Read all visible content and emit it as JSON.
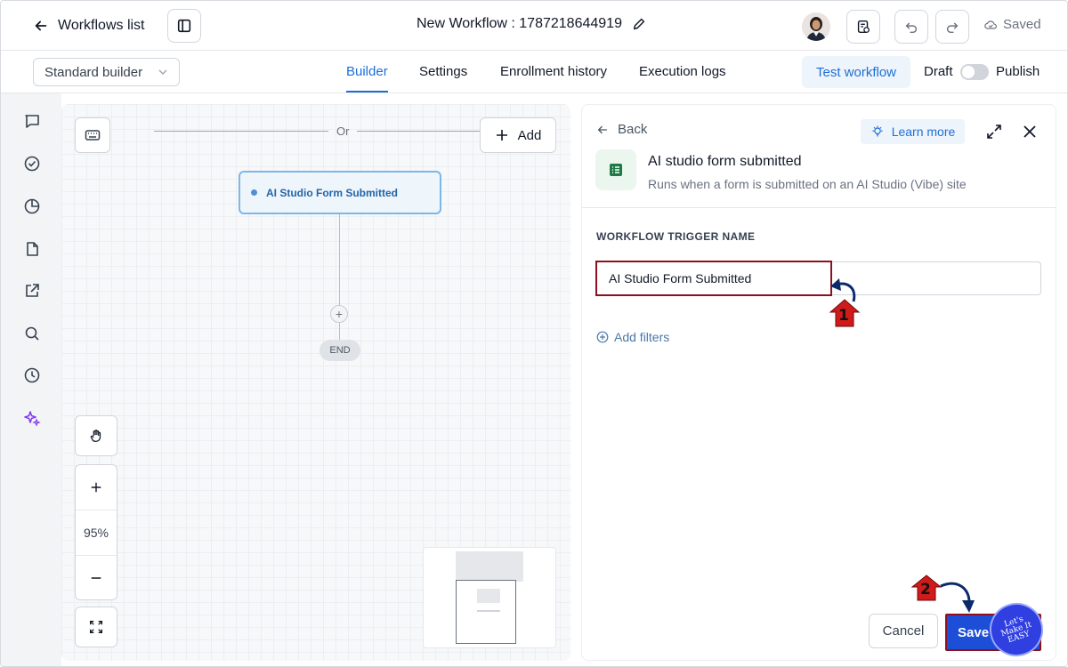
{
  "topbar": {
    "back_label": "Workflows list",
    "workflow_title": "New Workflow : 1787218644919",
    "saved_label": "Saved"
  },
  "subbar": {
    "builder_select": "Standard builder",
    "tabs": [
      {
        "label": "Builder",
        "active": true
      },
      {
        "label": "Settings",
        "active": false
      },
      {
        "label": "Enrollment history",
        "active": false
      },
      {
        "label": "Execution logs",
        "active": false
      }
    ],
    "test_label": "Test workflow",
    "draft_label": "Draft",
    "publish_label": "Publish",
    "publish_on": false
  },
  "canvas": {
    "or_label": "Or",
    "add_label": "Add",
    "trigger_node_label": "AI Studio Form Submitted",
    "end_label": "END",
    "zoom": "95%"
  },
  "panel": {
    "back_label": "Back",
    "learn_more_label": "Learn more",
    "trigger_title": "AI studio form submitted",
    "trigger_subtitle": "Runs when a form is submitted on an AI Studio (Vibe) site",
    "field_label": "WORKFLOW TRIGGER NAME",
    "field_value": "AI Studio Form Submitted",
    "add_filters_label": "Add filters",
    "cancel_label": "Cancel",
    "save_label": "Save"
  },
  "annotations": {
    "step1": "1",
    "step2": "2",
    "watermark": "Let's Make It EASY"
  },
  "colors": {
    "accent": "#1d6fd6",
    "save_button": "#1d4ed8",
    "highlight": "#8b1020",
    "annotation_arrow": "#0b2a6b",
    "badge_red": "#d11a1a"
  },
  "icons": {
    "rail": [
      "chat-icon",
      "check-circle-icon",
      "pie-chart-icon",
      "file-icon",
      "external-link-icon",
      "search-icon",
      "clock-icon",
      "sparkles-icon"
    ]
  }
}
